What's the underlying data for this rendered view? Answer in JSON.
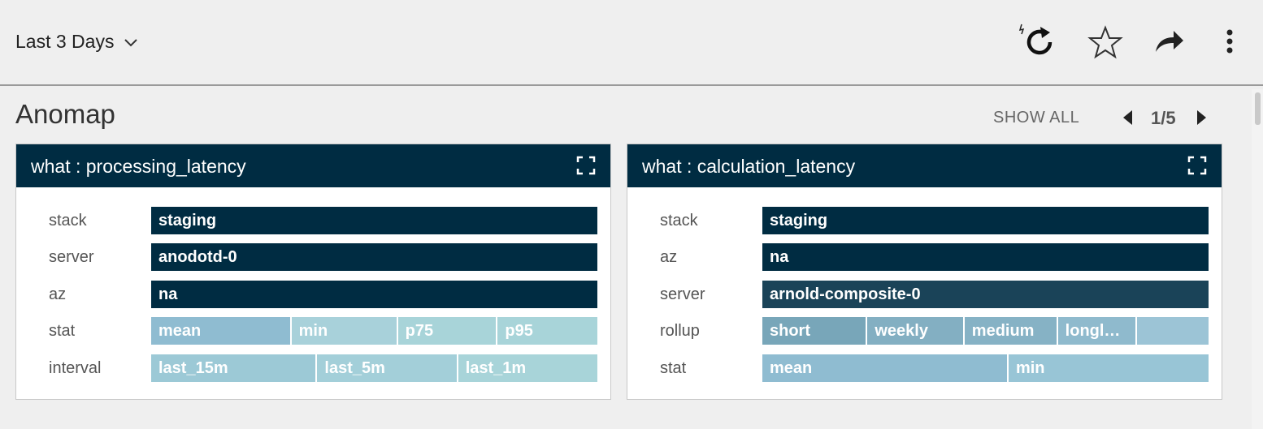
{
  "toolbar": {
    "time_range": "Last 3 Days",
    "icons": [
      "refresh-icon",
      "star-icon",
      "share-icon",
      "more-vertical-icon"
    ]
  },
  "page": {
    "title": "Anomap",
    "show_all": "SHOW ALL",
    "pager": "1/5"
  },
  "cards": [
    {
      "title": "what : processing_latency",
      "rows": [
        {
          "label": "stack",
          "segments": [
            {
              "text": "staging",
              "color": "#002c42",
              "weight": 1
            }
          ]
        },
        {
          "label": "server",
          "segments": [
            {
              "text": "anodotd-0",
              "color": "#002c42",
              "weight": 1
            }
          ]
        },
        {
          "label": "az",
          "segments": [
            {
              "text": "na",
              "color": "#002c42",
              "weight": 1
            }
          ]
        },
        {
          "label": "stat",
          "segments": [
            {
              "text": "mean",
              "color": "#8fbcd1",
              "weight": 175
            },
            {
              "text": "min",
              "color": "#a8d1da",
              "weight": 130
            },
            {
              "text": "p75",
              "color": "#a8d4d9",
              "weight": 121
            },
            {
              "text": "p95",
              "color": "#a8d4d9",
              "weight": 123
            }
          ]
        },
        {
          "label": "interval",
          "segments": [
            {
              "text": "last_15m",
              "color": "#9cc9d6",
              "weight": 205
            },
            {
              "text": "last_5m",
              "color": "#a3cfd9",
              "weight": 172
            },
            {
              "text": "last_1m",
              "color": "#a8d4d9",
              "weight": 172
            }
          ]
        }
      ]
    },
    {
      "title": "what : calculation_latency",
      "rows": [
        {
          "label": "stack",
          "segments": [
            {
              "text": "staging",
              "color": "#002c42",
              "weight": 1
            }
          ]
        },
        {
          "label": "az",
          "segments": [
            {
              "text": "na",
              "color": "#002c42",
              "weight": 1
            }
          ]
        },
        {
          "label": "server",
          "segments": [
            {
              "text": "arnold-composite-0",
              "color": "#1a4358",
              "weight": 1
            }
          ]
        },
        {
          "label": "rollup",
          "segments": [
            {
              "text": "short",
              "color": "#78a6b9",
              "weight": 131
            },
            {
              "text": "weekly",
              "color": "#83afc2",
              "weight": 120
            },
            {
              "text": "medium",
              "color": "#86b2c5",
              "weight": 115
            },
            {
              "text": "longl…",
              "color": "#8fbacd",
              "weight": 96
            },
            {
              "text": "",
              "color": "#9cc4d6",
              "weight": 87
            }
          ]
        },
        {
          "label": "stat",
          "segments": [
            {
              "text": "mean",
              "color": "#8fbcd1",
              "weight": 303
            },
            {
              "text": "min",
              "color": "#98c5d6",
              "weight": 246
            }
          ]
        }
      ]
    }
  ]
}
